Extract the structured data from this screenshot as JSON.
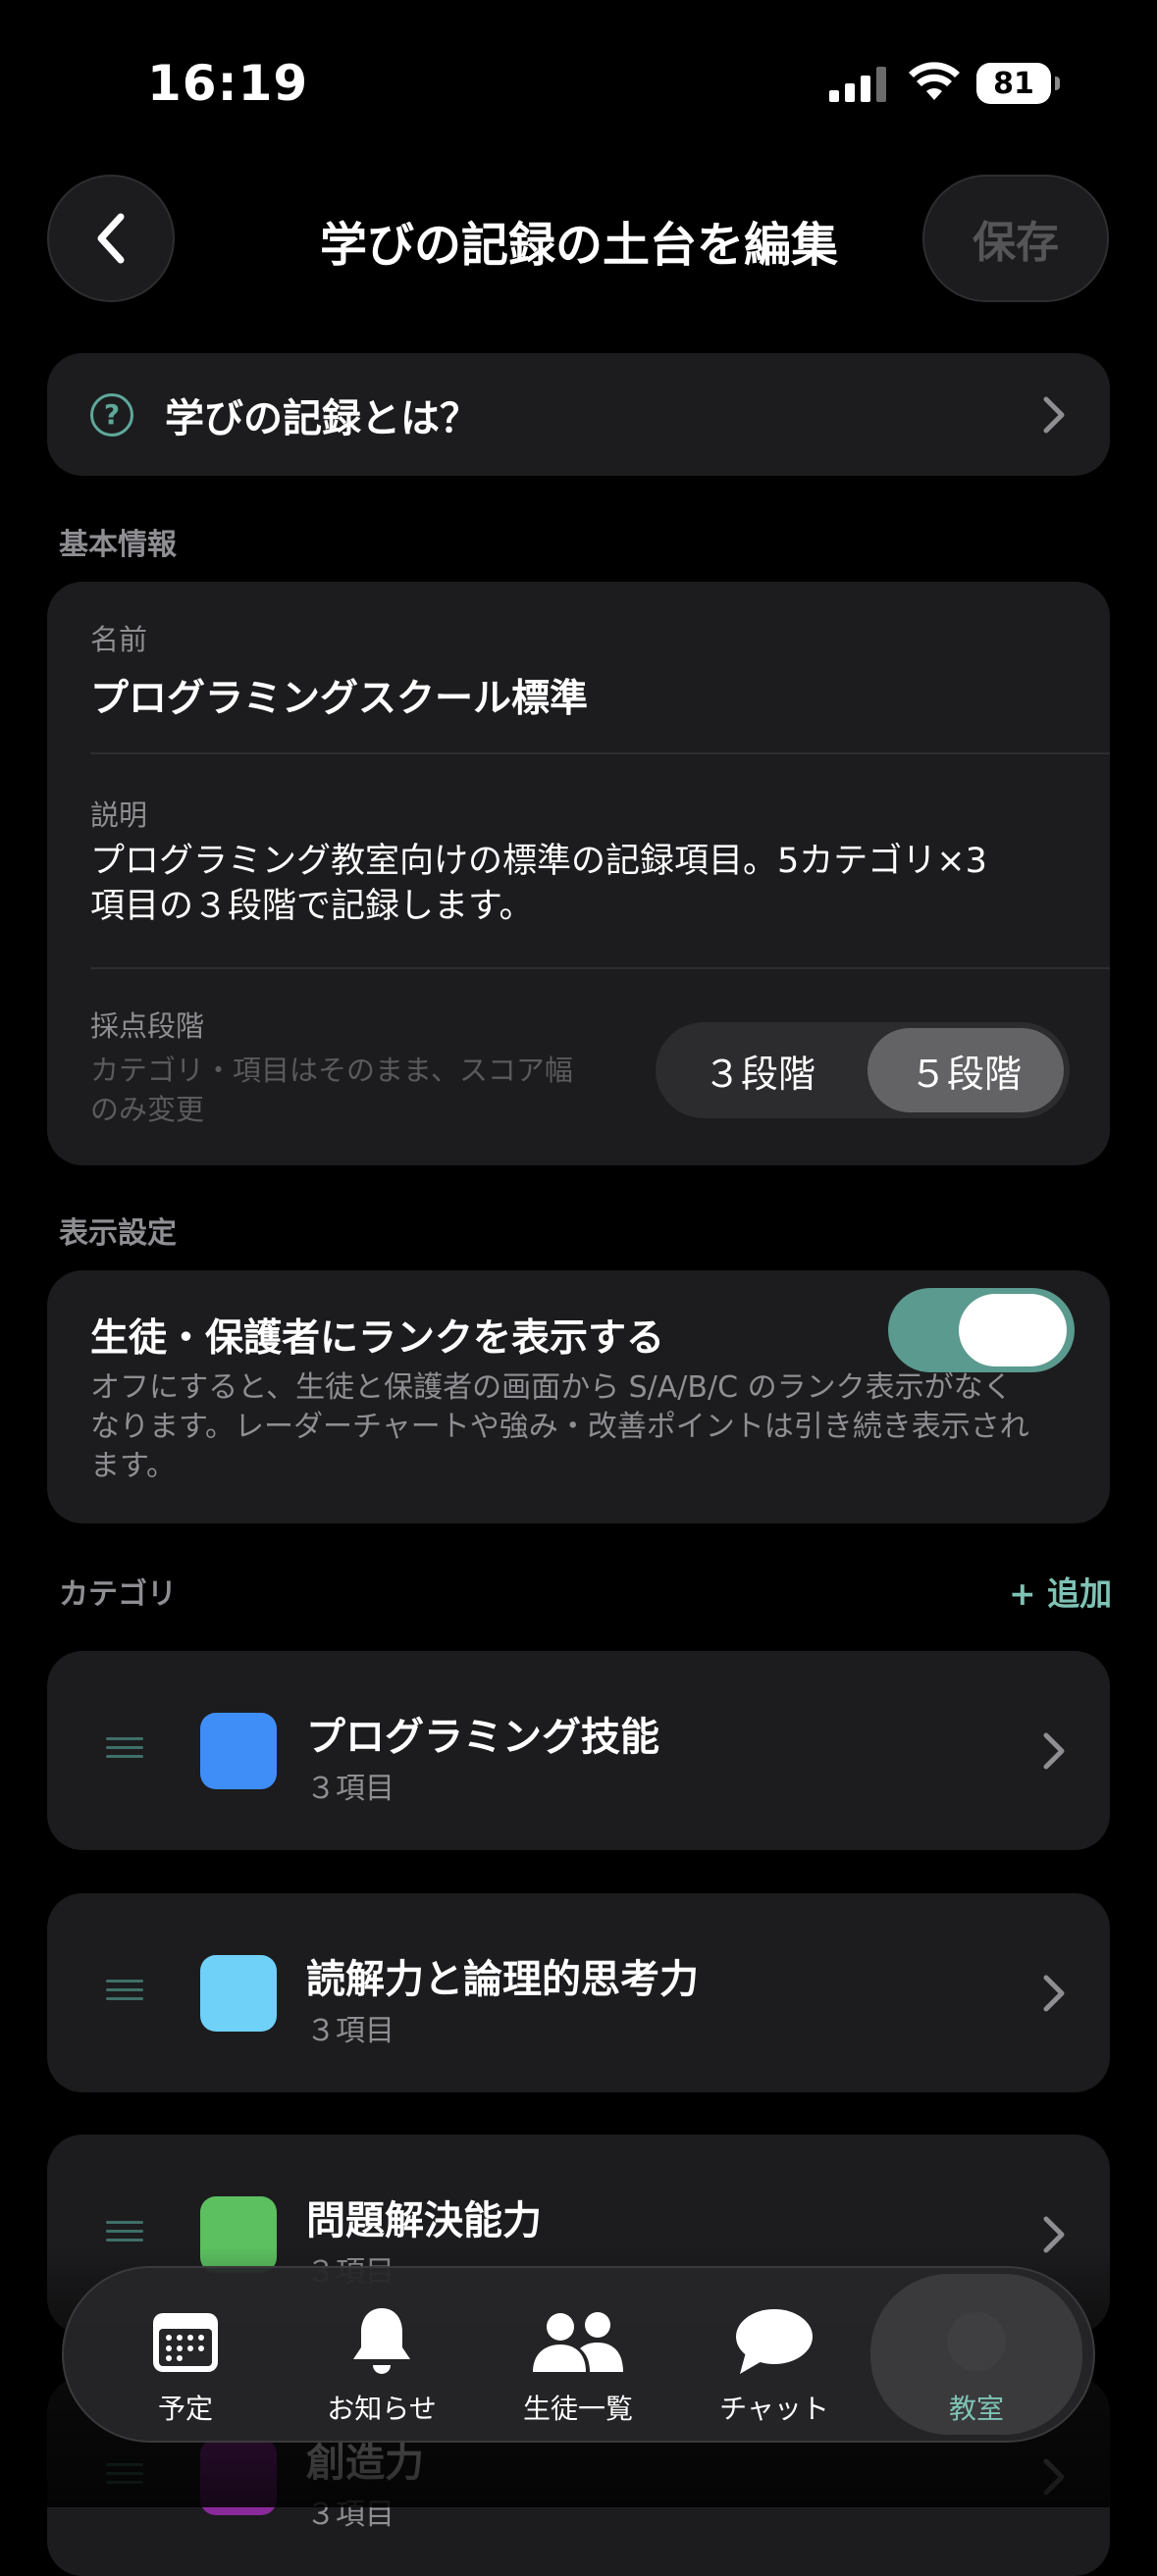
{
  "status_bar": {
    "time": "16:19",
    "battery": "81"
  },
  "header": {
    "title": "学びの記録の土台を編集",
    "save_label": "保存"
  },
  "help": {
    "label": "学びの記録とは？"
  },
  "basic_info": {
    "section_label": "基本情報",
    "name_label": "名前",
    "name_value": "プログラミングスクール標準",
    "description_label": "説明",
    "description_line1": "プログラミング教室向けの標準の記録項目。5カテゴリ×3",
    "description_line2": "項目の３段階で記録します。",
    "scoring_label": "採点段階",
    "scoring_hint_line1": "カテゴリ・項目はそのまま、スコア幅",
    "scoring_hint_line2": "のみ変更",
    "scoring_options": [
      "３段階",
      "５段階"
    ],
    "scoring_selected": "５段階"
  },
  "display_settings": {
    "section_label": "表示設定",
    "toggle_label": "生徒・保護者にランクを表示する",
    "toggle_on": true,
    "description_line1": "オフにすると、生徒と保護者の画面から S/A/B/C のランク表示がなく",
    "description_line2": "なります。レーダーチャートや強み・改善ポイントは引き続き表示され",
    "description_line3": "ます。"
  },
  "categories": {
    "section_label": "カテゴリ",
    "add_label": "+ 追加",
    "items": [
      {
        "name": "プログラミング技能",
        "count": "３項目",
        "color": "#3f8df7"
      },
      {
        "name": "読解力と論理的思考力",
        "count": "３項目",
        "color": "#6fd0f8"
      },
      {
        "name": "問題解決能力",
        "count": "３項目",
        "color": "#5cc060"
      },
      {
        "name": "創造力",
        "count": "３項目",
        "color": "#8a2a9a"
      }
    ]
  },
  "tabbar": {
    "tabs": [
      {
        "label": "予定",
        "icon": "calendar-icon"
      },
      {
        "label": "お知らせ",
        "icon": "bell-icon"
      },
      {
        "label": "生徒一覧",
        "icon": "people-icon"
      },
      {
        "label": "チャット",
        "icon": "chat-bubble-icon"
      },
      {
        "label": "教室",
        "icon": "classroom-icon"
      }
    ],
    "active": "教室"
  },
  "colors": {
    "accent": "#5b9a8e",
    "accent_text": "#7ec3b5",
    "background": "#000000",
    "card": "#1c1c1e"
  }
}
